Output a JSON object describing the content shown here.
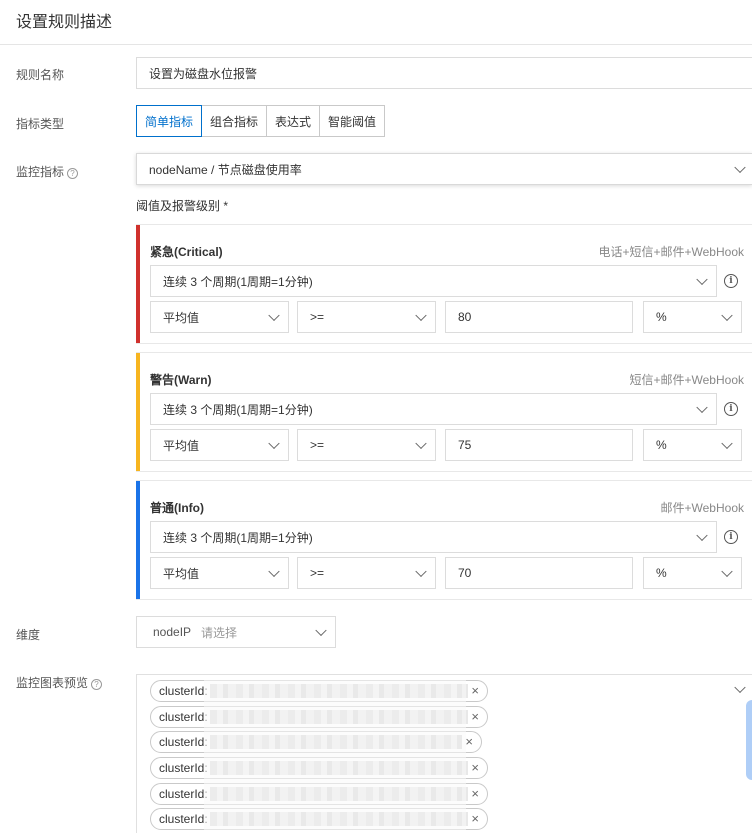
{
  "page_title": "设置规则描述",
  "form": {
    "rule_name_label": "规则名称",
    "rule_name_value": "设置为磁盘水位报警",
    "metric_type_label": "指标类型",
    "metric_type_tabs": [
      "简单指标",
      "组合指标",
      "表达式",
      "智能阈值"
    ],
    "metric_type_active": "简单指标",
    "metric_label": "监控指标",
    "metric_value": "nodeName / 节点磁盘使用率",
    "threshold_label": "阈值及报警级别 *",
    "dimension_label": "维度",
    "dimension_key": "nodeIP",
    "dimension_placeholder": "请选择",
    "preview_label": "监控图表预览"
  },
  "levels": [
    {
      "name": "紧急(Critical)",
      "channels": "电话+短信+邮件+WebHook",
      "period": "连续 3 个周期(1周期=1分钟)",
      "stat": "平均值",
      "operator": ">=",
      "threshold": "80",
      "unit": "%",
      "color": "#d0312d"
    },
    {
      "name": "警告(Warn)",
      "channels": "短信+邮件+WebHook",
      "period": "连续 3 个周期(1周期=1分钟)",
      "stat": "平均值",
      "operator": ">=",
      "threshold": "75",
      "unit": "%",
      "color": "#f7b520"
    },
    {
      "name": "普通(Info)",
      "channels": "邮件+WebHook",
      "period": "连续 3 个周期(1周期=1分钟)",
      "stat": "平均值",
      "operator": ">=",
      "threshold": "70",
      "unit": "%",
      "color": "#1a73e8"
    }
  ],
  "preview_tags": [
    "clusterId:",
    "clusterId:",
    "clusterId:",
    "clusterId:",
    "clusterId:",
    "clusterId:"
  ],
  "icons": {
    "help": "question-circle-icon",
    "info": "info-circle-icon",
    "dropdown": "chevron-down-icon",
    "remove": "close-icon"
  }
}
